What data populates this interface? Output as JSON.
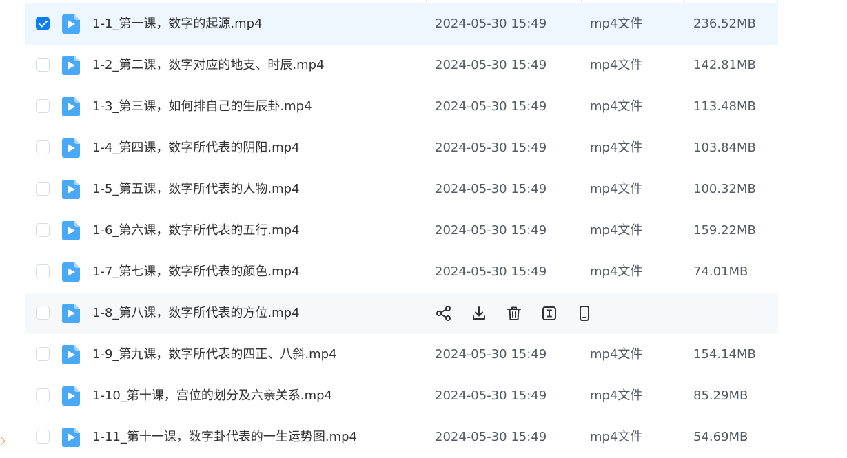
{
  "colors": {
    "accent": "#0a7ff5",
    "file_icon": "#4aa9f7",
    "selected_row": "#eef7ff",
    "hover_row": "#f7f8fa"
  },
  "icons": {
    "file": "video-file-icon",
    "checkbox": "checkbox-icon",
    "hover_actions": [
      "share-icon",
      "download-icon",
      "delete-icon",
      "rename-icon",
      "send-to-phone-icon"
    ]
  },
  "files": [
    {
      "name": "1-1_第一课，数字的起源.mp4",
      "date": "2024-05-30 15:49",
      "type": "mp4文件",
      "size": "236.52MB",
      "checked": true
    },
    {
      "name": "1-2_第二课，数字对应的地支、时辰.mp4",
      "date": "2024-05-30 15:49",
      "type": "mp4文件",
      "size": "142.81MB",
      "checked": false
    },
    {
      "name": "1-3_第三课，如何排自己的生辰卦.mp4",
      "date": "2024-05-30 15:49",
      "type": "mp4文件",
      "size": "113.48MB",
      "checked": false
    },
    {
      "name": "1-4_第四课，数字所代表的阴阳.mp4",
      "date": "2024-05-30 15:49",
      "type": "mp4文件",
      "size": "103.84MB",
      "checked": false
    },
    {
      "name": "1-5_第五课，数字所代表的人物.mp4",
      "date": "2024-05-30 15:49",
      "type": "mp4文件",
      "size": "100.32MB",
      "checked": false
    },
    {
      "name": "1-6_第六课，数字所代表的五行.mp4",
      "date": "2024-05-30 15:49",
      "type": "mp4文件",
      "size": "159.22MB",
      "checked": false
    },
    {
      "name": "1-7_第七课，数字所代表的颜色.mp4",
      "date": "2024-05-30 15:49",
      "type": "mp4文件",
      "size": "74.01MB",
      "checked": false
    },
    {
      "name": "1-8_第八课，数字所代表的方位.mp4",
      "hovered": true,
      "checked": false
    },
    {
      "name": "1-9_第九课，数字所代表的四正、八斜.mp4",
      "date": "2024-05-30 15:49",
      "type": "mp4文件",
      "size": "154.14MB",
      "checked": false
    },
    {
      "name": "1-10_第十课，宫位的划分及六亲关系.mp4",
      "date": "2024-05-30 15:49",
      "type": "mp4文件",
      "size": "85.29MB",
      "checked": false
    },
    {
      "name": "1-11_第十一课，数字卦代表的一生运势图.mp4",
      "date": "2024-05-30 15:49",
      "type": "mp4文件",
      "size": "54.69MB",
      "checked": false
    }
  ]
}
